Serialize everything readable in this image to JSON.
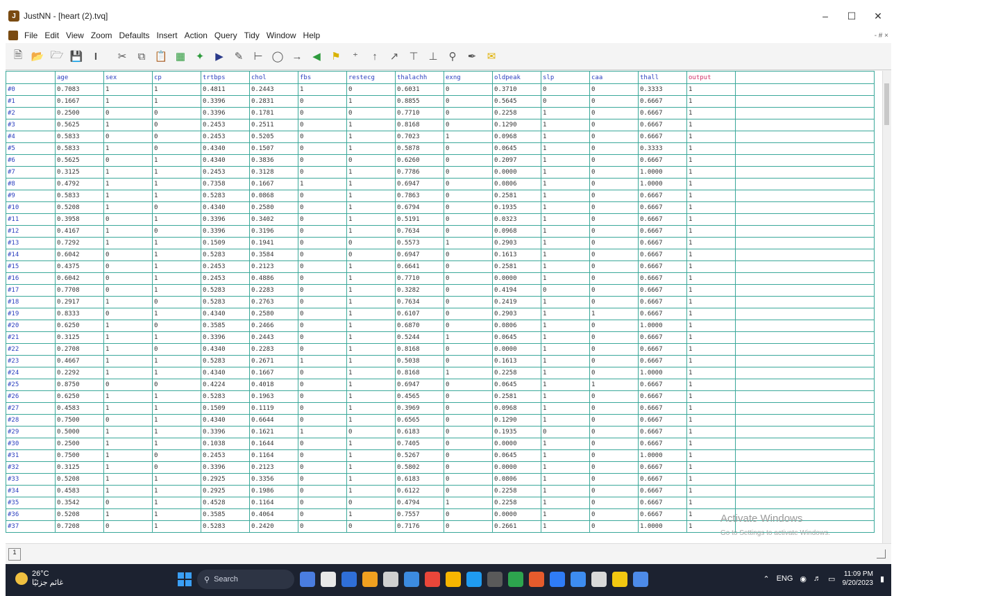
{
  "window": {
    "title": "JustNN - [heart (2).tvq]"
  },
  "menu": [
    "File",
    "Edit",
    "View",
    "Zoom",
    "Defaults",
    "Insert",
    "Action",
    "Query",
    "Tidy",
    "Window",
    "Help"
  ],
  "menu_right": "- # ×",
  "toolbar_icons": [
    "new-file-icon",
    "open-folder-icon",
    "open-icon",
    "save-icon",
    "cursor-icon",
    "cut-icon",
    "copy-icon",
    "paste-icon",
    "grid-icon",
    "network-icon",
    "learn-icon",
    "scissors-icon",
    "tree-icon",
    "query-icon",
    "arrow-right-icon",
    "arrow-left-icon",
    "flag-icon",
    "add-icon",
    "insert-icon",
    "insert-right-icon",
    "sort-icon",
    "sort-down-icon",
    "zoom-icon",
    "pen-icon",
    "email-icon"
  ],
  "grid": {
    "columns": [
      "age",
      "sex",
      "cp",
      "trtbps",
      "chol",
      "fbs",
      "restecg",
      "thalachh",
      "exng",
      "oldpeak",
      "slp",
      "caa",
      "thall",
      "output"
    ],
    "rows": [
      {
        "label": "#0",
        "cells": [
          "0.7083",
          "1",
          "1",
          "0.4811",
          "0.2443",
          "1",
          "0",
          "0.6031",
          "0",
          "0.3710",
          "0",
          "0",
          "0.3333",
          "1"
        ]
      },
      {
        "label": "#1",
        "cells": [
          "0.1667",
          "1",
          "1",
          "0.3396",
          "0.2831",
          "0",
          "1",
          "0.8855",
          "0",
          "0.5645",
          "0",
          "0",
          "0.6667",
          "1"
        ]
      },
      {
        "label": "#2",
        "cells": [
          "0.2500",
          "0",
          "0",
          "0.3396",
          "0.1781",
          "0",
          "0",
          "0.7710",
          "0",
          "0.2258",
          "1",
          "0",
          "0.6667",
          "1"
        ]
      },
      {
        "label": "#3",
        "cells": [
          "0.5625",
          "1",
          "0",
          "0.2453",
          "0.2511",
          "0",
          "1",
          "0.8168",
          "0",
          "0.1290",
          "1",
          "0",
          "0.6667",
          "1"
        ]
      },
      {
        "label": "#4",
        "cells": [
          "0.5833",
          "0",
          "0",
          "0.2453",
          "0.5205",
          "0",
          "1",
          "0.7023",
          "1",
          "0.0968",
          "1",
          "0",
          "0.6667",
          "1"
        ]
      },
      {
        "label": "#5",
        "cells": [
          "0.5833",
          "1",
          "0",
          "0.4340",
          "0.1507",
          "0",
          "1",
          "0.5878",
          "0",
          "0.0645",
          "1",
          "0",
          "0.3333",
          "1"
        ]
      },
      {
        "label": "#6",
        "cells": [
          "0.5625",
          "0",
          "1",
          "0.4340",
          "0.3836",
          "0",
          "0",
          "0.6260",
          "0",
          "0.2097",
          "1",
          "0",
          "0.6667",
          "1"
        ]
      },
      {
        "label": "#7",
        "cells": [
          "0.3125",
          "1",
          "1",
          "0.2453",
          "0.3128",
          "0",
          "1",
          "0.7786",
          "0",
          "0.0000",
          "1",
          "0",
          "1.0000",
          "1"
        ]
      },
      {
        "label": "#8",
        "cells": [
          "0.4792",
          "1",
          "1",
          "0.7358",
          "0.1667",
          "1",
          "1",
          "0.6947",
          "0",
          "0.0806",
          "1",
          "0",
          "1.0000",
          "1"
        ]
      },
      {
        "label": "#9",
        "cells": [
          "0.5833",
          "1",
          "1",
          "0.5283",
          "0.0868",
          "0",
          "1",
          "0.7863",
          "0",
          "0.2581",
          "1",
          "0",
          "0.6667",
          "1"
        ]
      },
      {
        "label": "#10",
        "cells": [
          "0.5208",
          "1",
          "0",
          "0.4340",
          "0.2580",
          "0",
          "1",
          "0.6794",
          "0",
          "0.1935",
          "1",
          "0",
          "0.6667",
          "1"
        ]
      },
      {
        "label": "#11",
        "cells": [
          "0.3958",
          "0",
          "1",
          "0.3396",
          "0.3402",
          "0",
          "1",
          "0.5191",
          "0",
          "0.0323",
          "1",
          "0",
          "0.6667",
          "1"
        ]
      },
      {
        "label": "#12",
        "cells": [
          "0.4167",
          "1",
          "0",
          "0.3396",
          "0.3196",
          "0",
          "1",
          "0.7634",
          "0",
          "0.0968",
          "1",
          "0",
          "0.6667",
          "1"
        ]
      },
      {
        "label": "#13",
        "cells": [
          "0.7292",
          "1",
          "1",
          "0.1509",
          "0.1941",
          "0",
          "0",
          "0.5573",
          "1",
          "0.2903",
          "1",
          "0",
          "0.6667",
          "1"
        ]
      },
      {
        "label": "#14",
        "cells": [
          "0.6042",
          "0",
          "1",
          "0.5283",
          "0.3584",
          "0",
          "0",
          "0.6947",
          "0",
          "0.1613",
          "1",
          "0",
          "0.6667",
          "1"
        ]
      },
      {
        "label": "#15",
        "cells": [
          "0.4375",
          "0",
          "1",
          "0.2453",
          "0.2123",
          "0",
          "1",
          "0.6641",
          "0",
          "0.2581",
          "1",
          "0",
          "0.6667",
          "1"
        ]
      },
      {
        "label": "#16",
        "cells": [
          "0.6042",
          "0",
          "1",
          "0.2453",
          "0.4886",
          "0",
          "1",
          "0.7710",
          "0",
          "0.0000",
          "1",
          "0",
          "0.6667",
          "1"
        ]
      },
      {
        "label": "#17",
        "cells": [
          "0.7708",
          "0",
          "1",
          "0.5283",
          "0.2283",
          "0",
          "1",
          "0.3282",
          "0",
          "0.4194",
          "0",
          "0",
          "0.6667",
          "1"
        ]
      },
      {
        "label": "#18",
        "cells": [
          "0.2917",
          "1",
          "0",
          "0.5283",
          "0.2763",
          "0",
          "1",
          "0.7634",
          "0",
          "0.2419",
          "1",
          "0",
          "0.6667",
          "1"
        ]
      },
      {
        "label": "#19",
        "cells": [
          "0.8333",
          "0",
          "1",
          "0.4340",
          "0.2580",
          "0",
          "1",
          "0.6107",
          "0",
          "0.2903",
          "1",
          "1",
          "0.6667",
          "1"
        ]
      },
      {
        "label": "#20",
        "cells": [
          "0.6250",
          "1",
          "0",
          "0.3585",
          "0.2466",
          "0",
          "1",
          "0.6870",
          "0",
          "0.0806",
          "1",
          "0",
          "1.0000",
          "1"
        ]
      },
      {
        "label": "#21",
        "cells": [
          "0.3125",
          "1",
          "1",
          "0.3396",
          "0.2443",
          "0",
          "1",
          "0.5244",
          "1",
          "0.0645",
          "1",
          "0",
          "0.6667",
          "1"
        ]
      },
      {
        "label": "#22",
        "cells": [
          "0.2708",
          "1",
          "0",
          "0.4340",
          "0.2283",
          "0",
          "1",
          "0.8168",
          "0",
          "0.0000",
          "1",
          "0",
          "0.6667",
          "1"
        ]
      },
      {
        "label": "#23",
        "cells": [
          "0.4667",
          "1",
          "1",
          "0.5283",
          "0.2671",
          "1",
          "1",
          "0.5038",
          "0",
          "0.1613",
          "1",
          "0",
          "0.6667",
          "1"
        ]
      },
      {
        "label": "#24",
        "cells": [
          "0.2292",
          "1",
          "1",
          "0.4340",
          "0.1667",
          "0",
          "1",
          "0.8168",
          "1",
          "0.2258",
          "1",
          "0",
          "1.0000",
          "1"
        ]
      },
      {
        "label": "#25",
        "cells": [
          "0.8750",
          "0",
          "0",
          "0.4224",
          "0.4018",
          "0",
          "1",
          "0.6947",
          "0",
          "0.0645",
          "1",
          "1",
          "0.6667",
          "1"
        ]
      },
      {
        "label": "#26",
        "cells": [
          "0.6250",
          "1",
          "1",
          "0.5283",
          "0.1963",
          "0",
          "1",
          "0.4565",
          "0",
          "0.2581",
          "1",
          "0",
          "0.6667",
          "1"
        ]
      },
      {
        "label": "#27",
        "cells": [
          "0.4583",
          "1",
          "1",
          "0.1509",
          "0.1119",
          "0",
          "1",
          "0.3969",
          "0",
          "0.0968",
          "1",
          "0",
          "0.6667",
          "1"
        ]
      },
      {
        "label": "#28",
        "cells": [
          "0.7500",
          "0",
          "1",
          "0.4340",
          "0.6644",
          "0",
          "1",
          "0.6565",
          "0",
          "0.1290",
          "1",
          "0",
          "0.6667",
          "1"
        ]
      },
      {
        "label": "#29",
        "cells": [
          "0.5000",
          "1",
          "1",
          "0.3396",
          "0.1621",
          "1",
          "0",
          "0.6183",
          "0",
          "0.1935",
          "0",
          "0",
          "0.6667",
          "1"
        ]
      },
      {
        "label": "#30",
        "cells": [
          "0.2500",
          "1",
          "1",
          "0.1038",
          "0.1644",
          "0",
          "1",
          "0.7405",
          "0",
          "0.0000",
          "1",
          "0",
          "0.6667",
          "1"
        ]
      },
      {
        "label": "#31",
        "cells": [
          "0.7500",
          "1",
          "0",
          "0.2453",
          "0.1164",
          "0",
          "1",
          "0.5267",
          "0",
          "0.0645",
          "1",
          "0",
          "1.0000",
          "1"
        ]
      },
      {
        "label": "#32",
        "cells": [
          "0.3125",
          "1",
          "0",
          "0.3396",
          "0.2123",
          "0",
          "1",
          "0.5802",
          "0",
          "0.0000",
          "1",
          "0",
          "0.6667",
          "1"
        ]
      },
      {
        "label": "#33",
        "cells": [
          "0.5208",
          "1",
          "1",
          "0.2925",
          "0.3356",
          "0",
          "1",
          "0.6183",
          "0",
          "0.0806",
          "1",
          "0",
          "0.6667",
          "1"
        ]
      },
      {
        "label": "#34",
        "cells": [
          "0.4583",
          "1",
          "1",
          "0.2925",
          "0.1986",
          "0",
          "1",
          "0.6122",
          "0",
          "0.2258",
          "1",
          "0",
          "0.6667",
          "1"
        ]
      },
      {
        "label": "#35",
        "cells": [
          "0.3542",
          "0",
          "1",
          "0.4528",
          "0.1164",
          "0",
          "0",
          "0.4794",
          "1",
          "0.2258",
          "1",
          "0",
          "0.6667",
          "1"
        ]
      },
      {
        "label": "#36",
        "cells": [
          "0.5208",
          "1",
          "1",
          "0.3585",
          "0.4064",
          "0",
          "1",
          "0.7557",
          "0",
          "0.0000",
          "1",
          "0",
          "0.6667",
          "1"
        ]
      },
      {
        "label": "#37",
        "cells": [
          "0.7208",
          "0",
          "1",
          "0.5283",
          "0.2420",
          "0",
          "0",
          "0.7176",
          "0",
          "0.2661",
          "1",
          "0",
          "1.0000",
          "1"
        ]
      }
    ]
  },
  "status": {
    "page_indicator": "1"
  },
  "watermark": {
    "title": "Activate Windows",
    "subtitle": "Go to Settings to activate Windows."
  },
  "taskbar": {
    "weather_temp": "26°C",
    "weather_desc": "غائم جزئيًا",
    "search_placeholder": "Search",
    "lang": "ENG",
    "time": "11:09 PM",
    "date": "9/20/2023",
    "app_colors": [
      "#4a7de0",
      "#e8e8e8",
      "#2f6fd8",
      "#f0a020",
      "#d0d0d0",
      "#3c8be0",
      "#e9463a",
      "#f7b500",
      "#1f9bf0",
      "#5a5a5a",
      "#2da44e",
      "#e55b2c",
      "#2f7cf6",
      "#3d8cf0",
      "#d9d9d9",
      "#f2c811",
      "#4d8be8"
    ]
  }
}
